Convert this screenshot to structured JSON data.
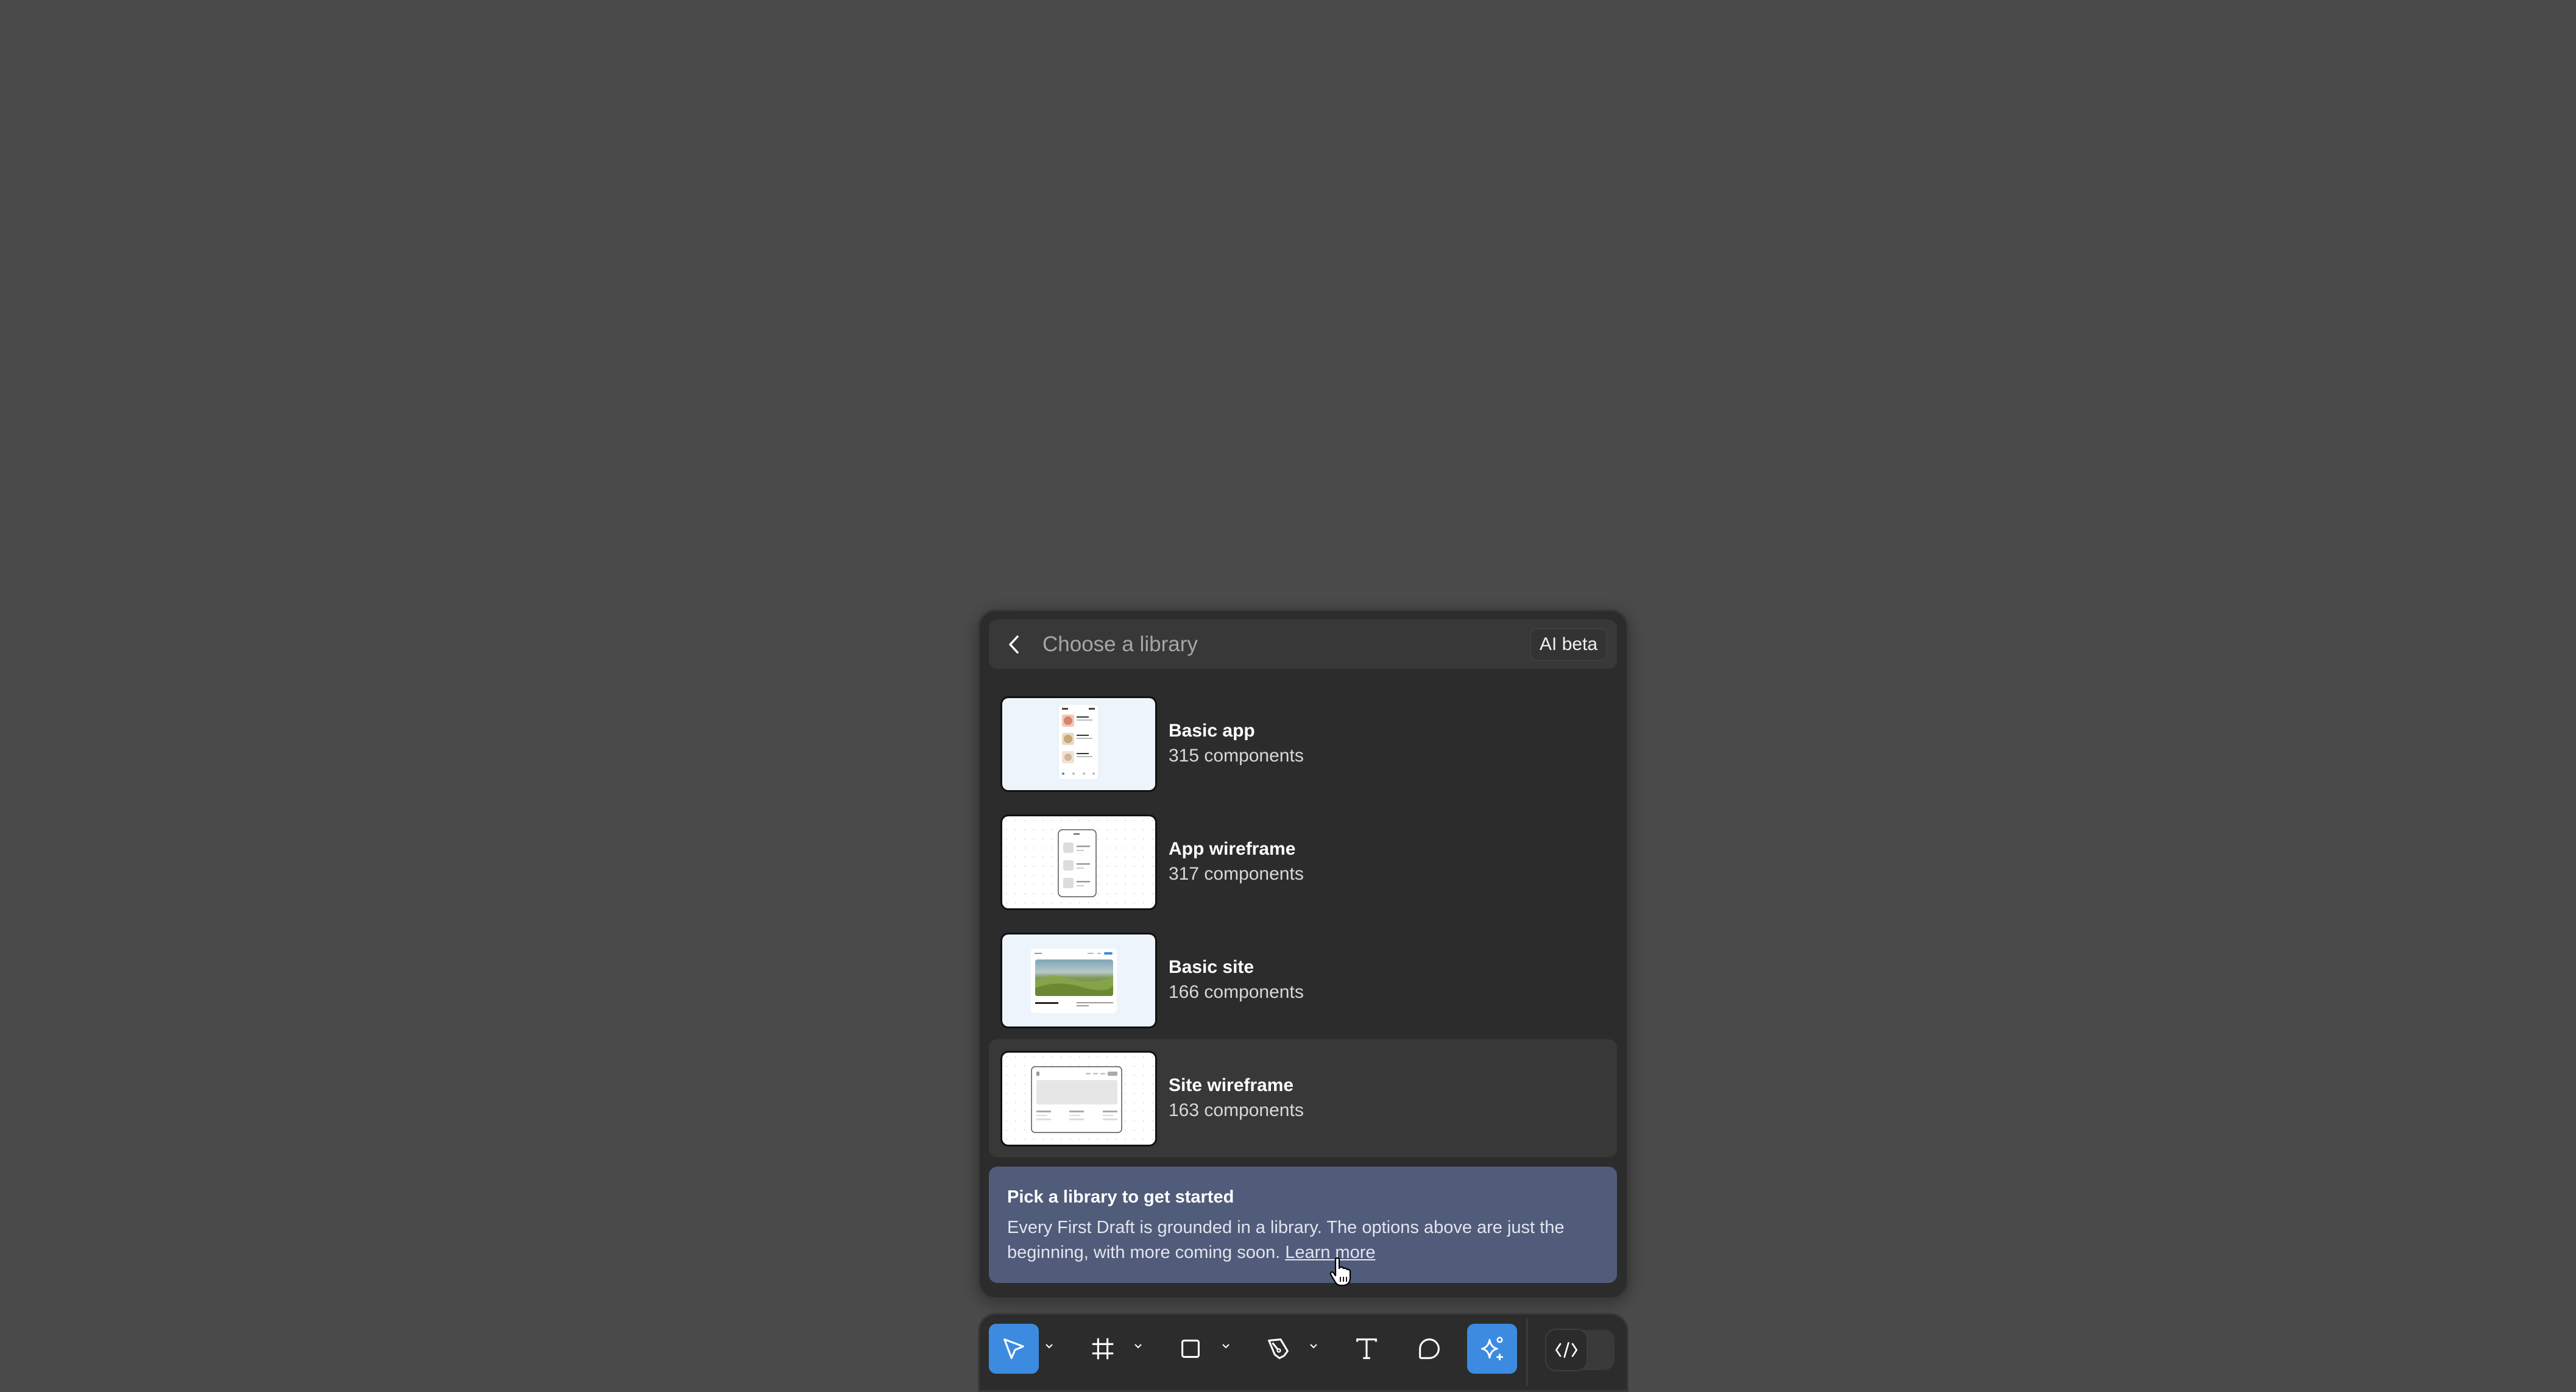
{
  "header": {
    "back_icon": "chevron-left-icon",
    "title": "Choose a library",
    "badge": "AI beta"
  },
  "libraries": [
    {
      "name": "Basic app",
      "count": "315 components",
      "thumbnail": "basic-app-preview"
    },
    {
      "name": "App wireframe",
      "count": "317 components",
      "thumbnail": "app-wireframe-preview"
    },
    {
      "name": "Basic site",
      "count": "166 components",
      "thumbnail": "basic-site-preview"
    },
    {
      "name": "Site wireframe",
      "count": "163 components",
      "thumbnail": "site-wireframe-preview",
      "hovered": true
    }
  ],
  "info": {
    "title": "Pick a library to get started",
    "body": "Every First Draft is grounded in a library. The options above are just the beginning, with more coming soon.",
    "link": "Learn more"
  },
  "toolbar": {
    "tools": [
      {
        "name": "move",
        "icon": "cursor-arrow-icon",
        "active": true,
        "has_menu": true
      },
      {
        "name": "frame",
        "icon": "frame-hash-icon",
        "active": false,
        "has_menu": true
      },
      {
        "name": "shape",
        "icon": "rectangle-icon",
        "active": false,
        "has_menu": true
      },
      {
        "name": "pen",
        "icon": "pen-icon",
        "active": false,
        "has_menu": true
      },
      {
        "name": "text",
        "icon": "text-icon",
        "active": false,
        "has_menu": false
      },
      {
        "name": "comment",
        "icon": "comment-icon",
        "active": false,
        "has_menu": false
      },
      {
        "name": "ai",
        "icon": "ai-sparkle-icon",
        "active": true,
        "has_menu": false
      }
    ],
    "dev_mode_icon": "code-icon",
    "dev_mode_on": false
  },
  "colors": {
    "accent": "#3d8be0",
    "info_bg": "#515b7a",
    "panel_bg": "#2c2c2c",
    "canvas_bg": "#4b4b4b"
  }
}
